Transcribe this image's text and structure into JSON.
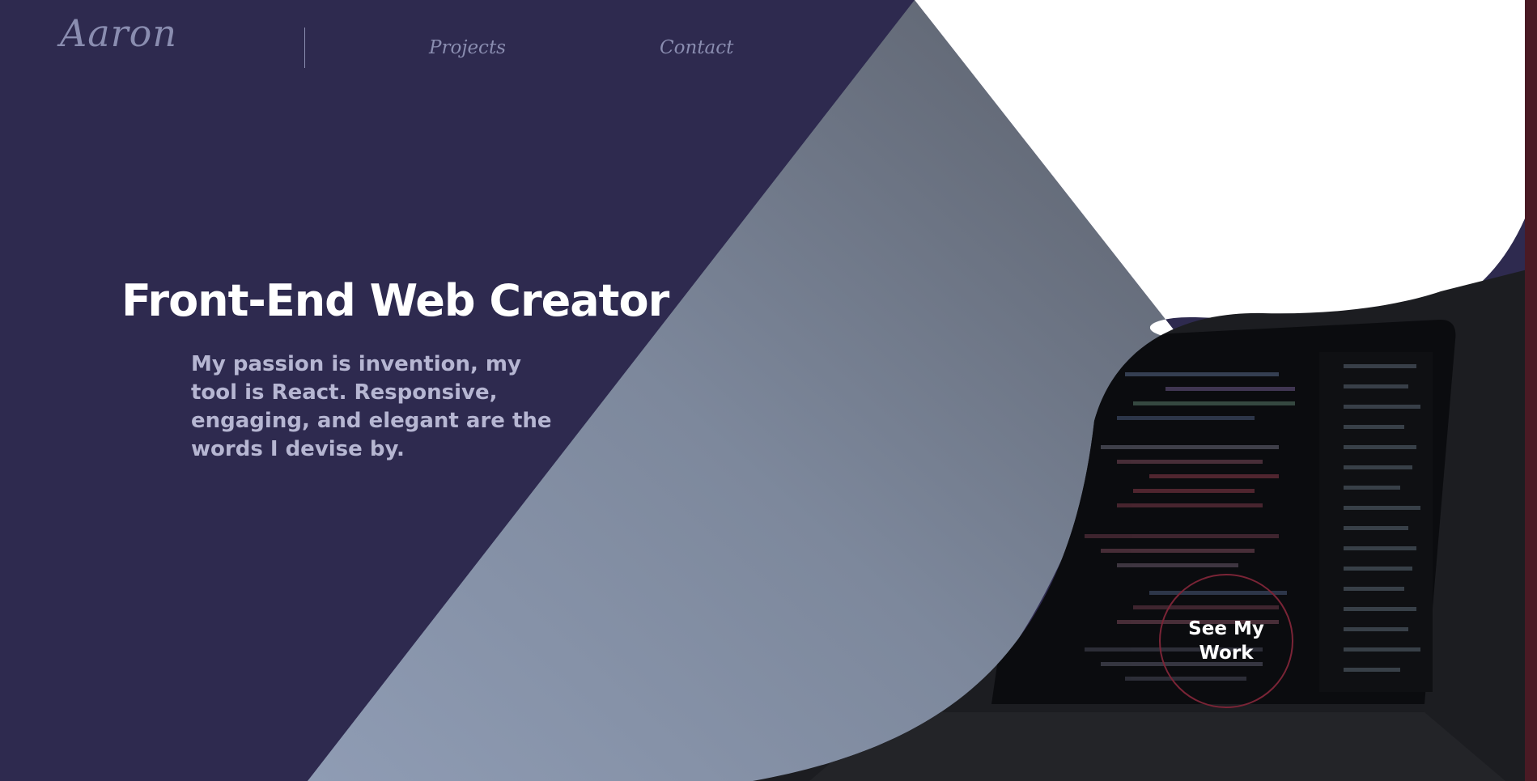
{
  "nav": {
    "logo": "Aaron",
    "projects_label": "Projects",
    "contact_label": "Contact"
  },
  "hero": {
    "title": "Front-End Web Creator",
    "subtitle": "My passion is invention, my tool is React. Responsive, engaging, and elegant are the words I devise by."
  },
  "cta": {
    "label": "See My Work"
  },
  "colors": {
    "background": "#2e2a4f",
    "diagonal_light": "#8b98b0",
    "diagonal_dark": "#5f6470",
    "nav_text": "#8a8db0",
    "subtitle_text": "#b6b6d2",
    "cta_ring": "#7a2436",
    "right_strip": "#4a1a24"
  },
  "icons": {
    "background_photo": "laptop-code-photo"
  }
}
